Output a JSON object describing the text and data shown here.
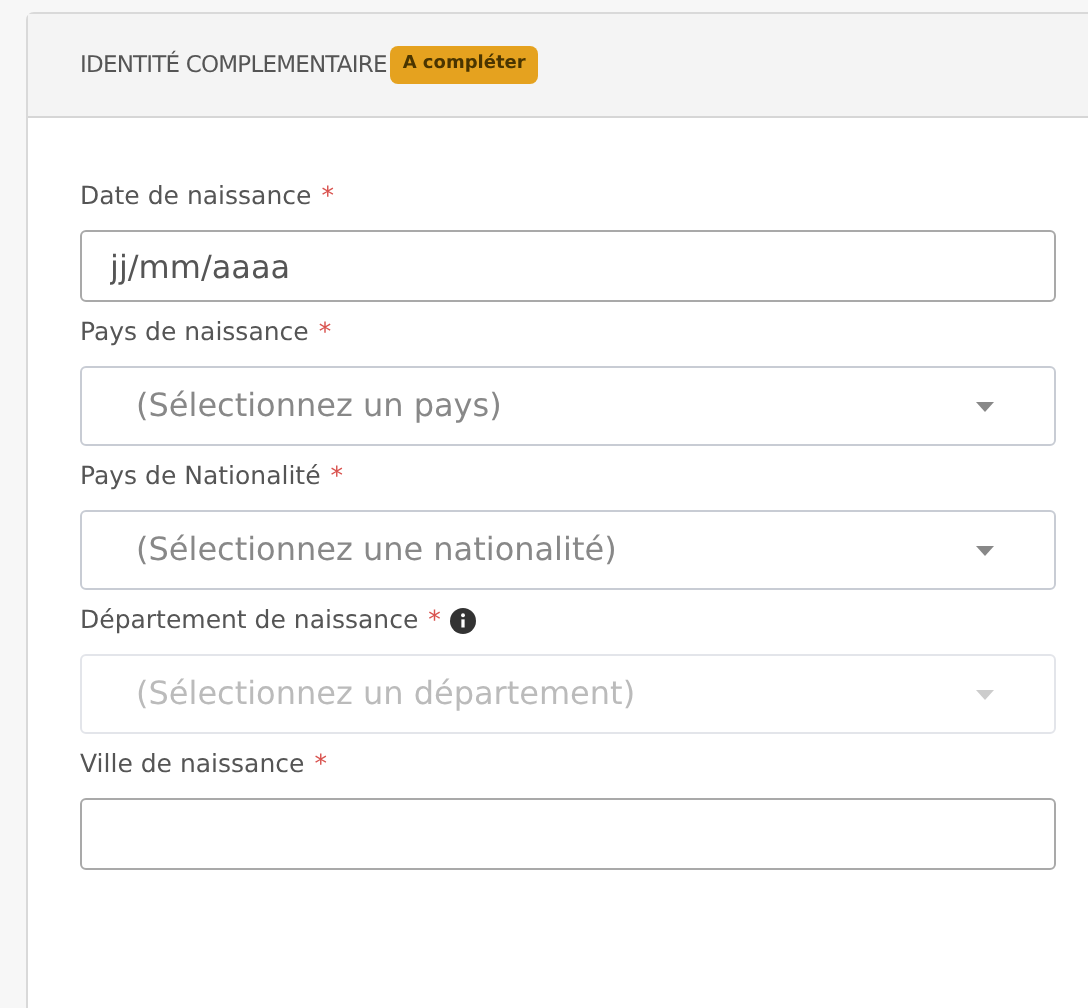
{
  "card": {
    "title": "IDENTITÉ COMPLEMENTAIRE",
    "badge": "A compléter"
  },
  "fields": [
    {
      "kind": "date",
      "label": "Date de naissance",
      "required_mark": "*",
      "placeholder": "jj/mm/aaaa",
      "disabled": false,
      "info": false
    },
    {
      "kind": "select",
      "label": "Pays de naissance",
      "required_mark": "*",
      "placeholder": "(Sélectionnez un pays)",
      "disabled": false,
      "info": false
    },
    {
      "kind": "select",
      "label": "Pays de Nationalité",
      "required_mark": "*",
      "placeholder": "(Sélectionnez une nationalité)",
      "disabled": false,
      "info": false
    },
    {
      "kind": "select",
      "label": "Département de naissance",
      "required_mark": "*",
      "placeholder": "(Sélectionnez un département)",
      "disabled": true,
      "info": true
    },
    {
      "kind": "text",
      "label": "Ville de naissance",
      "required_mark": "*",
      "disabled": false,
      "info": false
    }
  ]
}
